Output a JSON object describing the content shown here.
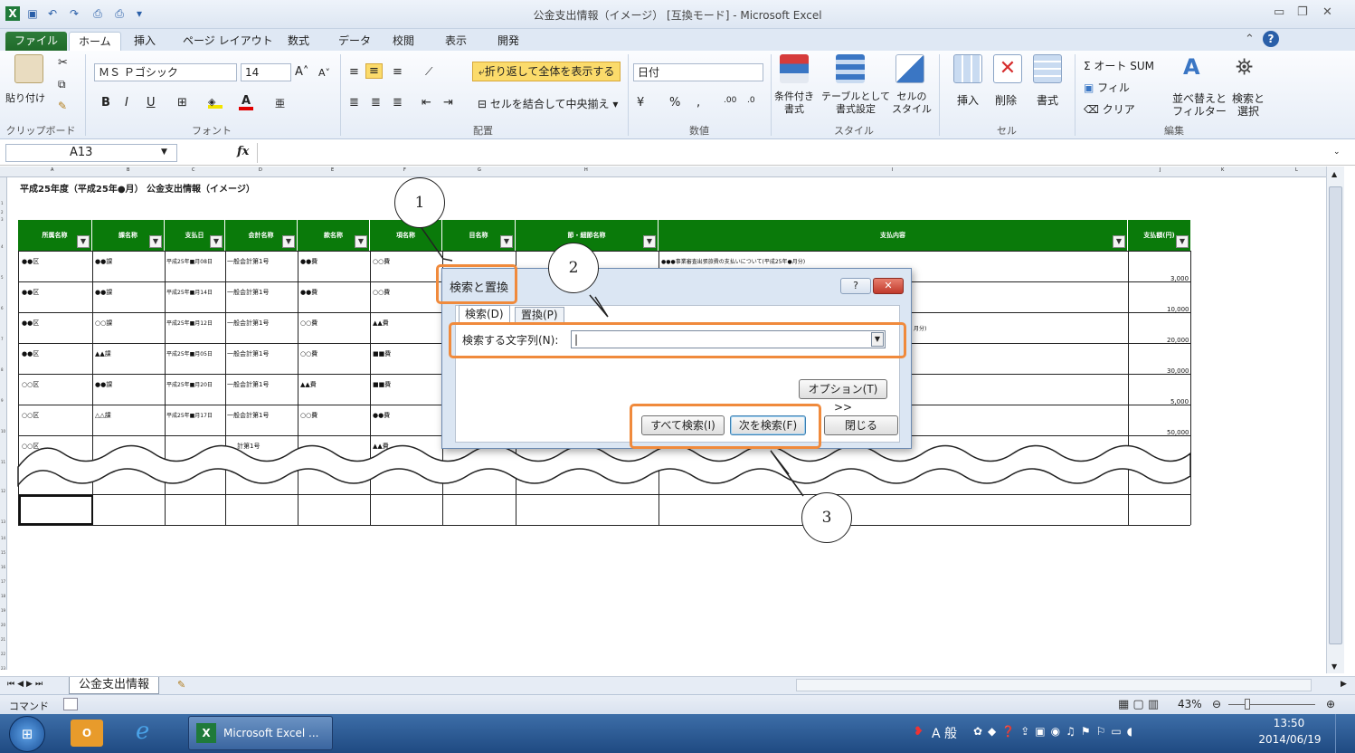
{
  "window": {
    "title": "公金支出情報（イメージ）  [互換モード] - Microsoft Excel"
  },
  "quick_access": {
    "icons": [
      "excel-logo-icon",
      "save-icon",
      "undo-icon",
      "redo-icon",
      "print-preview-icon",
      "quick-print-icon",
      "customize-icon"
    ]
  },
  "tabs": [
    "ファイル",
    "ホーム",
    "挿入",
    "ページ レイアウト",
    "数式",
    "データ",
    "校閲",
    "表示",
    "開発"
  ],
  "ribbon": {
    "clipboard": {
      "paste": "貼り付け",
      "label": "クリップボード"
    },
    "font": {
      "name": "ＭＳ Ｐゴシック",
      "size": "14",
      "label": "フォント",
      "bold": "B",
      "italic": "I",
      "underline": "U"
    },
    "alignment": {
      "wrap": "折り返して全体を表示する",
      "merge": "セルを結合して中央揃え",
      "label": "配置"
    },
    "number": {
      "format": "日付",
      "percent": "%",
      "comma": ",",
      "label": "数値"
    },
    "styles": {
      "conditional": [
        "条件付き",
        "書式"
      ],
      "table": [
        "テーブルとして",
        "書式設定"
      ],
      "cell": [
        "セルの",
        "スタイル"
      ],
      "label": "スタイル"
    },
    "cells": {
      "insert": "挿入",
      "delete": "削除",
      "format": "書式",
      "label": "セル"
    },
    "editing": {
      "autosum": "Σ オート SUM",
      "fill": "フィル",
      "clear": "クリア",
      "sort": [
        "並べ替えと",
        "フィルター"
      ],
      "find": [
        "検索と",
        "選択"
      ],
      "label": "編集"
    }
  },
  "formula_bar": {
    "name_box": "A13",
    "fx": "fx"
  },
  "columns": [
    "A",
    "B",
    "C",
    "D",
    "E",
    "F",
    "G",
    "H",
    "I",
    "J",
    "K",
    "L"
  ],
  "sheet": {
    "title": "平成25年度（平成25年●月） 公金支出情報（イメージ）",
    "headers": [
      "所属名称",
      "課名称",
      "支払日",
      "会計名称",
      "款名称",
      "項名称",
      "目名称",
      "節・細節名称",
      "支払内容",
      "支払額(円)"
    ],
    "rows": [
      {
        "a": "●●区",
        "b": "●●課",
        "c": "平成25年■月08日",
        "d": "一般会計第1号",
        "e": "●●費",
        "f": "○○費",
        "i": "●●●事業審査出張旅費の支払いについて(平成25年●月分)",
        "j": "3,000"
      },
      {
        "a": "●●区",
        "b": "●●課",
        "c": "平成25年■月14日",
        "d": "一般会計第1号",
        "e": "●●費",
        "f": "○○費",
        "i": "",
        "j": "10,000"
      },
      {
        "a": "●●区",
        "b": "○○課",
        "c": "平成25年■月12日",
        "d": "一般会計第1号",
        "e": "○○費",
        "f": "▲▲費",
        "i": "月分)",
        "j": "20,000"
      },
      {
        "a": "●●区",
        "b": "▲▲課",
        "c": "平成25年■月05日",
        "d": "一般会計第1号",
        "e": "○○費",
        "f": "■■費",
        "i": "",
        "j": "30,000"
      },
      {
        "a": "○○区",
        "b": "●●課",
        "c": "平成25年■月20日",
        "d": "一般会計第1号",
        "e": "▲▲費",
        "f": "■■費",
        "i": "",
        "j": "5,000"
      },
      {
        "a": "○○区",
        "b": "△△課",
        "c": "平成25年■月17日",
        "d": "一般会計第1号",
        "e": "○○費",
        "f": "●●費",
        "i": "",
        "j": "50,000"
      },
      {
        "a": "○○区",
        "b": "",
        "c": "",
        "d": "計第1号",
        "e": "",
        "f": "▲▲費",
        "i": "",
        "j": ""
      }
    ]
  },
  "sheet_tabs": {
    "active": "公金支出情報"
  },
  "status": {
    "mode": "コマンド",
    "zoom": "43%"
  },
  "taskbar": {
    "app": "Microsoft Excel ...",
    "ime": "A 般",
    "time": "13:50",
    "date": "2014/06/19"
  },
  "dialog": {
    "title": "検索と置換",
    "tab_find": "検索(D)",
    "tab_replace": "置換(P)",
    "field_label": "検索する文字列(N):",
    "field_value": "",
    "options": "オプション(T) >>",
    "find_all": "すべて検索(I)",
    "find_next": "次を検索(F)",
    "close": "閉じる"
  },
  "callouts": [
    "1",
    "2",
    "3"
  ],
  "colors": {
    "excel_green": "#0a7a0a",
    "highlight_orange": "#f08a3c",
    "ribbon_blue": "#dfe8f4"
  }
}
